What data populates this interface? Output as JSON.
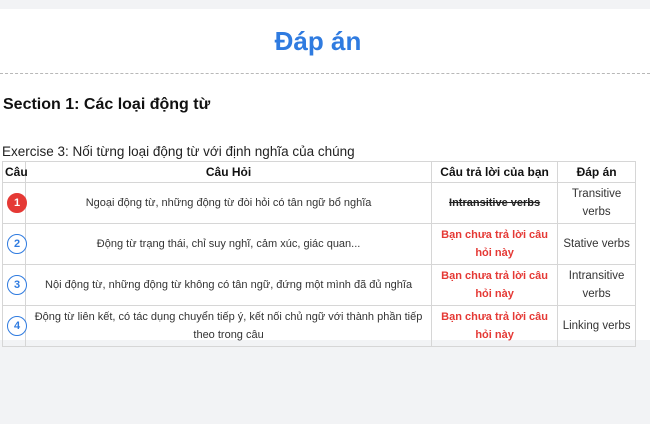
{
  "header": {
    "title": "Đáp án"
  },
  "section": {
    "title": "Section 1: Các loại động từ"
  },
  "exercise": {
    "title": "Exercise 3: Nối từng loại động từ với định nghĩa của chúng"
  },
  "table": {
    "headers": {
      "num": "Câu",
      "question": "Câu Hỏi",
      "your_answer": "Câu trả lời của bạn",
      "answer": "Đáp án"
    },
    "rows": [
      {
        "num": "1",
        "status": "wrong",
        "question": "Ngoại động từ, những động từ đòi hỏi có tân ngữ bổ nghĩa",
        "your_answer": "Intransitive verbs",
        "answer": "Transitive verbs"
      },
      {
        "num": "2",
        "status": "unanswered",
        "question": "Động từ trạng thái, chỉ suy nghĩ, cảm xúc, giác quan...",
        "your_answer": "Bạn chưa trả lời câu hỏi này",
        "answer": "Stative verbs"
      },
      {
        "num": "3",
        "status": "unanswered",
        "question": "Nội động từ, những động từ không có tân ngữ, đứng một mình đã đủ nghĩa",
        "your_answer": "Bạn chưa trả lời câu hỏi này",
        "answer": "Intransitive verbs"
      },
      {
        "num": "4",
        "status": "unanswered",
        "question": "Động từ liên kết, có tác dụng chuyển tiếp ý, kết nối chủ ngữ với thành phần tiếp theo trong câu",
        "your_answer": "Bạn chưa trả lời câu hỏi này",
        "answer": "Linking verbs"
      }
    ]
  },
  "colors": {
    "accent": "#2f7be0",
    "error": "#e53935"
  }
}
